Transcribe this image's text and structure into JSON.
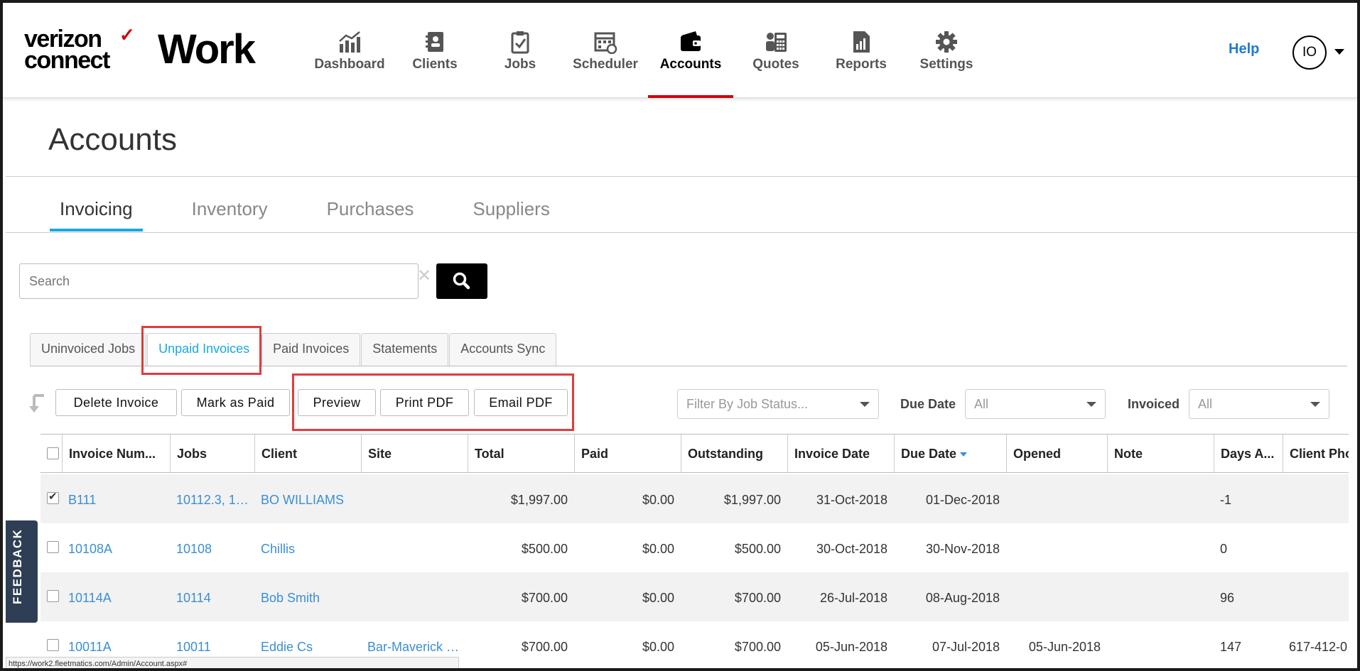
{
  "brand": {
    "vz_line1": "verizon",
    "vz_line2": "connect",
    "check": "✓",
    "work": "Work"
  },
  "nav": [
    {
      "label": "Dashboard",
      "icon": "dashboard-icon"
    },
    {
      "label": "Clients",
      "icon": "clients-icon"
    },
    {
      "label": "Jobs",
      "icon": "jobs-icon"
    },
    {
      "label": "Scheduler",
      "icon": "scheduler-icon"
    },
    {
      "label": "Accounts",
      "icon": "wallet-icon",
      "active": true
    },
    {
      "label": "Quotes",
      "icon": "quotes-icon"
    },
    {
      "label": "Reports",
      "icon": "reports-icon"
    },
    {
      "label": "Settings",
      "icon": "gear-icon"
    }
  ],
  "header": {
    "help": "Help",
    "avatar": "IO"
  },
  "page": {
    "title": "Accounts"
  },
  "subtabs": [
    "Invoicing",
    "Inventory",
    "Purchases",
    "Suppliers"
  ],
  "search": {
    "placeholder": "Search",
    "clear": "✕"
  },
  "tabs": [
    "Uninvoiced Jobs",
    "Unpaid Invoices",
    "Paid Invoices",
    "Statements",
    "Accounts Sync"
  ],
  "actions": {
    "delete": "Delete Invoice",
    "mark_paid": "Mark as Paid",
    "preview": "Preview",
    "print_pdf": "Print PDF",
    "email_pdf": "Email PDF"
  },
  "filters": {
    "job_status_placeholder": "Filter By Job Status...",
    "due_date_label": "Due Date",
    "due_date_value": "All",
    "invoiced_label": "Invoiced",
    "invoiced_value": "All"
  },
  "table": {
    "headers": [
      "Invoice Num...",
      "Jobs",
      "Client",
      "Site",
      "Total",
      "Paid",
      "Outstanding",
      "Invoice Date",
      "Due Date",
      "Opened",
      "Note",
      "Days A...",
      "Client Pho"
    ],
    "rows": [
      {
        "checked": true,
        "invoice": "B111",
        "jobs": "10112.3, 1…",
        "client": "BO WILLIAMS",
        "site": "",
        "total": "$1,997.00",
        "paid": "$0.00",
        "outstanding": "$1,997.00",
        "invoice_date": "31-Oct-2018",
        "due_date": "01-Dec-2018",
        "opened": "",
        "note": "",
        "days": "-1",
        "phone": ""
      },
      {
        "checked": false,
        "invoice": "10108A",
        "jobs": "10108",
        "client": "Chillis",
        "site": "",
        "total": "$500.00",
        "paid": "$0.00",
        "outstanding": "$500.00",
        "invoice_date": "30-Oct-2018",
        "due_date": "30-Nov-2018",
        "opened": "",
        "note": "",
        "days": "0",
        "phone": ""
      },
      {
        "checked": false,
        "invoice": "10114A",
        "jobs": "10114",
        "client": "Bob Smith",
        "site": "",
        "total": "$700.00",
        "paid": "$0.00",
        "outstanding": "$700.00",
        "invoice_date": "26-Jul-2018",
        "due_date": "08-Aug-2018",
        "opened": "",
        "note": "",
        "days": "96",
        "phone": ""
      },
      {
        "checked": false,
        "invoice": "10011A",
        "jobs": "10011",
        "client": "Eddie Cs",
        "site": "Bar-Maverick …",
        "total": "$700.00",
        "paid": "$0.00",
        "outstanding": "$700.00",
        "invoice_date": "05-Jun-2018",
        "due_date": "07-Jul-2018",
        "opened": "05-Jun-2018",
        "note": "",
        "days": "147",
        "phone": "617-412-0"
      }
    ]
  },
  "feedback": "FEEDBACK",
  "status_url": "https://work2.fleetmatics.com/Admin/Account.aspx#",
  "colors": {
    "accent_red": "#cd040b",
    "link_blue": "#3a8fd4",
    "tab_blue": "#1aa7e3",
    "highlight": "#e03c3c"
  }
}
